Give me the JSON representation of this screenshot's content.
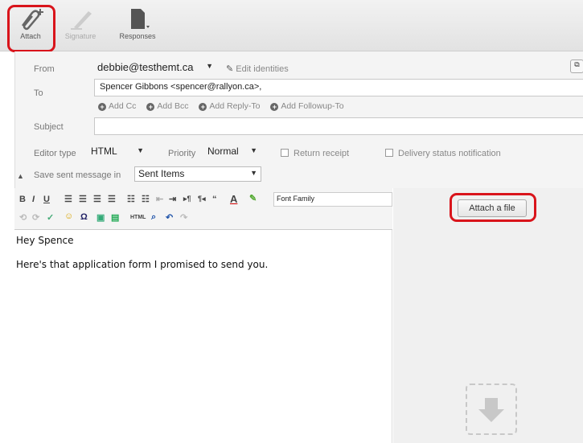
{
  "toolbar": {
    "attach_label": "Attach",
    "signature_label": "Signature",
    "responses_label": "Responses"
  },
  "header": {
    "from_label": "From",
    "from_value": "debbie@testhemt.ca",
    "edit_identities": "Edit identities",
    "to_label": "To",
    "to_value": "Spencer Gibbons <spencer@rallyon.ca>,",
    "add_links": [
      "Add Cc",
      "Add Bcc",
      "Add Reply-To",
      "Add Followup-To"
    ],
    "subject_label": "Subject",
    "subject_value": "",
    "editor_type_label": "Editor type",
    "editor_type_value": "HTML",
    "priority_label": "Priority",
    "priority_value": "Normal",
    "return_receipt": "Return receipt",
    "delivery_status": "Delivery status notification",
    "save_sent_label": "Save sent message in",
    "save_sent_value": "Sent Items"
  },
  "editor": {
    "font_family": "Font Family",
    "lines": [
      "Hey Spence",
      "Here's that application form I promised to send you."
    ]
  },
  "attachments": {
    "attach_button": "Attach a file"
  },
  "colors": {
    "highlight": "#d9141b"
  }
}
